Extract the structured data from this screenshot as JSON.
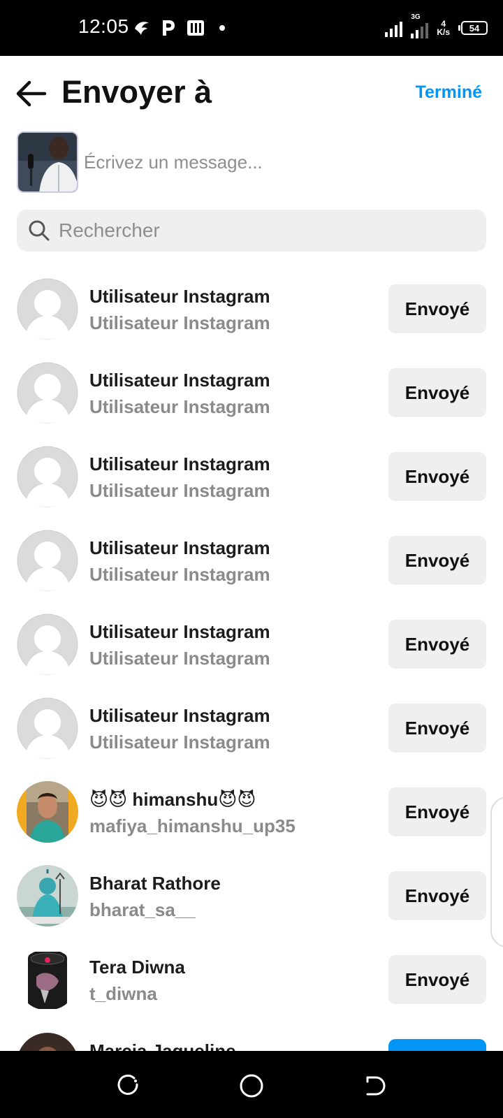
{
  "status_bar": {
    "time": "12:05",
    "left_icons": [
      "hawk-icon",
      "p-icon",
      "pdf-icon",
      "dot-icon"
    ],
    "net_speed_value": "4",
    "net_speed_unit": "K/s",
    "network_type": "3G",
    "battery": "54"
  },
  "header": {
    "title": "Envoyer à",
    "done_label": "Terminé"
  },
  "compose": {
    "placeholder": "Écrivez un message..."
  },
  "search": {
    "placeholder": "Rechercher"
  },
  "contacts": [
    {
      "name": "Utilisateur Instagram",
      "username": "Utilisateur Instagram",
      "button": "Envoyé",
      "avatar": "default-avatar"
    },
    {
      "name": "Utilisateur Instagram",
      "username": "Utilisateur Instagram",
      "button": "Envoyé",
      "avatar": "default-avatar"
    },
    {
      "name": "Utilisateur Instagram",
      "username": "Utilisateur Instagram",
      "button": "Envoyé",
      "avatar": "default-avatar"
    },
    {
      "name": "Utilisateur Instagram",
      "username": "Utilisateur Instagram",
      "button": "Envoyé",
      "avatar": "default-avatar"
    },
    {
      "name": "Utilisateur Instagram",
      "username": "Utilisateur Instagram",
      "button": "Envoyé",
      "avatar": "default-avatar"
    },
    {
      "name": "Utilisateur Instagram",
      "username": "Utilisateur Instagram",
      "button": "Envoyé",
      "avatar": "default-avatar"
    },
    {
      "name": "😈😈 himanshu😈😈",
      "username": "mafiya_himanshu_up35",
      "button": "Envoyé",
      "avatar": "photo-avatar"
    },
    {
      "name": "Bharat Rathore",
      "username": "bharat_sa__",
      "button": "Envoyé",
      "avatar": "photo-avatar"
    },
    {
      "name": "Tera Diwna",
      "username": "t_diwna",
      "button": "Envoyé",
      "avatar": "photo-avatar"
    },
    {
      "name": "Marcia Jaqueline",
      "username": "",
      "button": "",
      "avatar": "photo-avatar"
    }
  ],
  "colors": {
    "accent": "#0095f6",
    "button_bg": "#efefef",
    "secondary_text": "#8a8a8a"
  },
  "nav": [
    "recents-button",
    "home-button",
    "back-button"
  ]
}
